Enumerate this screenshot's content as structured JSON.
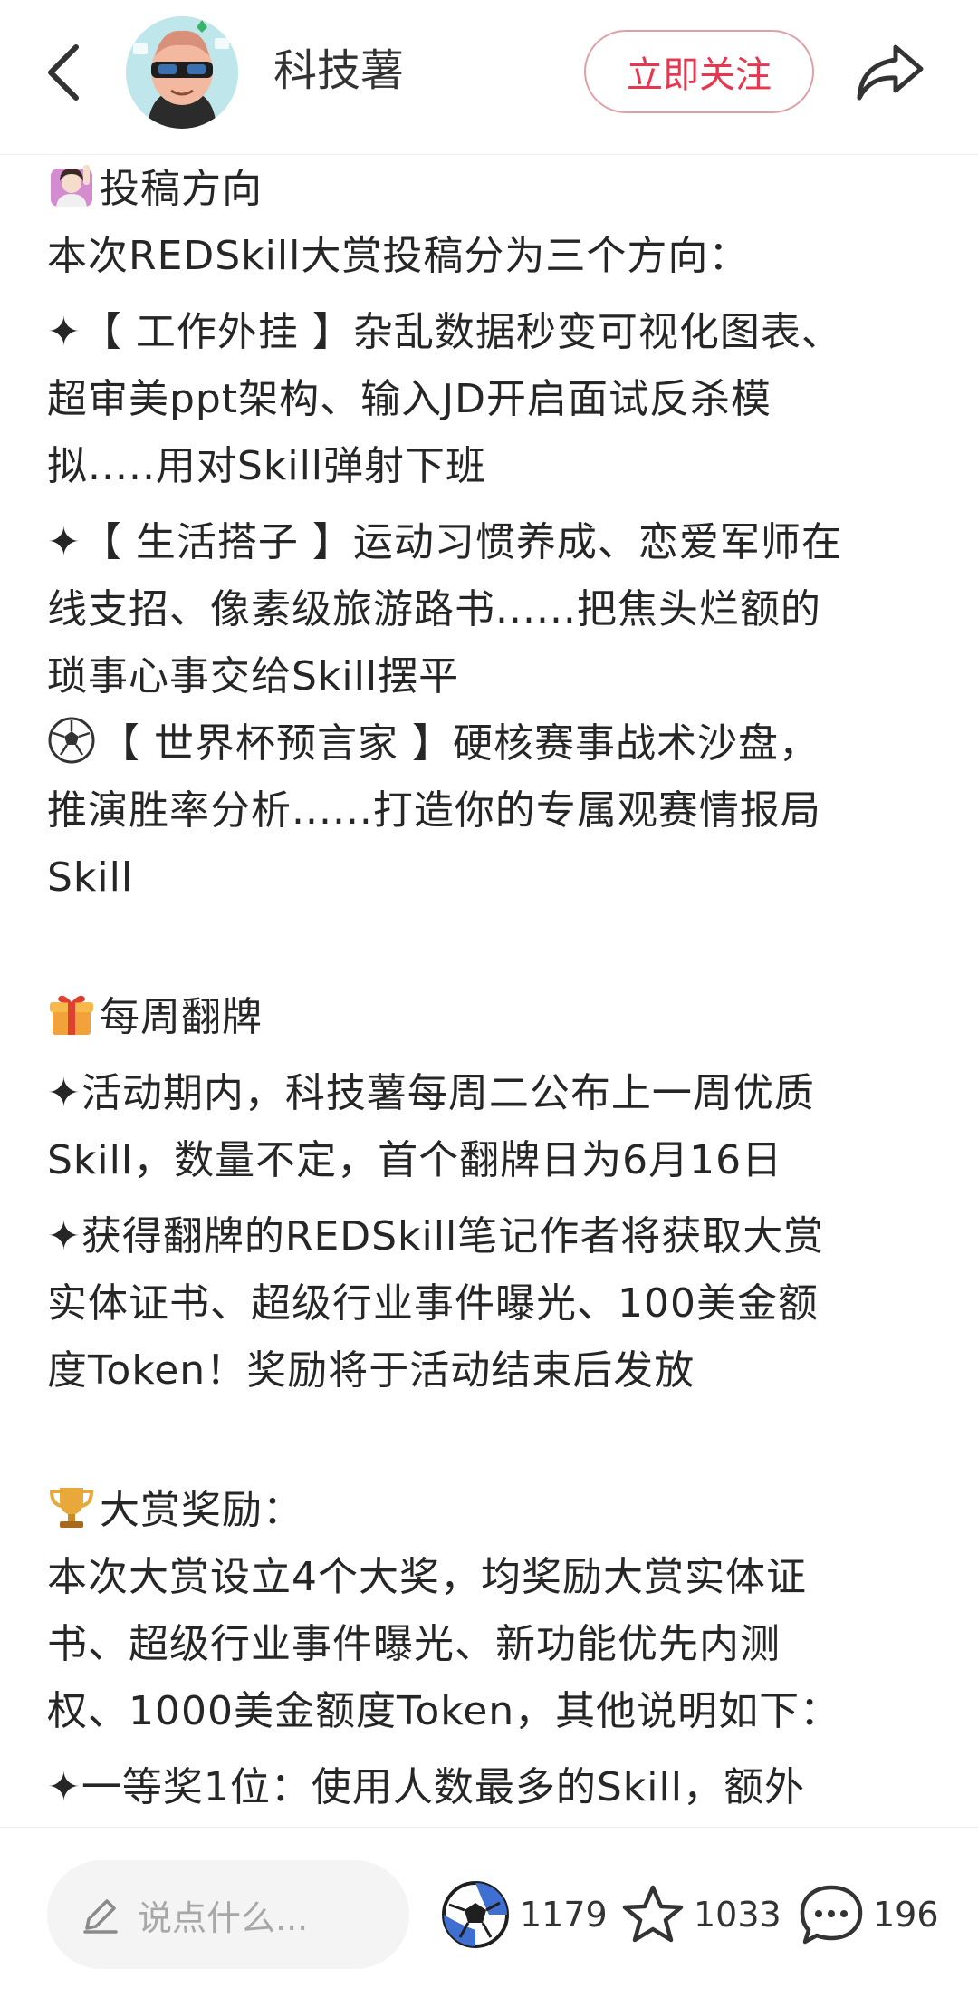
{
  "header": {
    "author_name": "科技薯",
    "follow_label": "立即关注"
  },
  "content": {
    "lines": [
      "投稿方向",
      "本次REDSkill大赏投稿分为三个方向：",
      "✦【 工作外挂 】杂乱数据秒变可视化图表、",
      "超审美ppt架构、输入JD开启面试反杀模",
      "拟.....用对Skill弹射下班",
      "✦【 生活搭子 】运动习惯养成、恋爱军师在",
      "线支招、像素级旅游路书......把焦头烂额的",
      "琐事心事交给Skill摆平",
      "【 世界杯预言家 】硬核赛事战术沙盘，",
      "推演胜率分析......打造你的专属观赛情报局",
      "Skill",
      "每周翻牌",
      "✦活动期内，科技薯每周二公布上一周优质",
      "Skill，数量不定，首个翻牌日为6月16日",
      "✦获得翻牌的REDSkill笔记作者将获取大赏",
      "实体证书、超级行业事件曝光、100美金额",
      "度Token！奖励将于活动结束后发放",
      "大赏奖励：",
      "本次大赏设立4个大奖，均奖励大赏实体证",
      "书、超级行业事件曝光、新功能优先内测",
      "权、1000美金额度Token，其他说明如下：",
      "✦一等奖1位：使用人数最多的Skill，额外"
    ]
  },
  "bottom": {
    "comment_placeholder": "说点什么...",
    "like_count": "1179",
    "collect_count": "1033",
    "comment_count": "196"
  },
  "icons": {
    "back": "chevron-left-icon",
    "share": "share-arrow-icon",
    "raise_hand": "person-raising-hand-emoji",
    "soccer": "soccer-ball-emoji",
    "gift": "wrapped-gift-emoji",
    "trophy": "trophy-emoji",
    "pencil": "pencil-icon",
    "like": "soccer-ball-like-icon",
    "star": "star-outline-icon",
    "comment": "speech-bubble-icon"
  },
  "colors": {
    "accent": "#e8364f",
    "text": "#262626",
    "muted": "#a8a8a8"
  }
}
